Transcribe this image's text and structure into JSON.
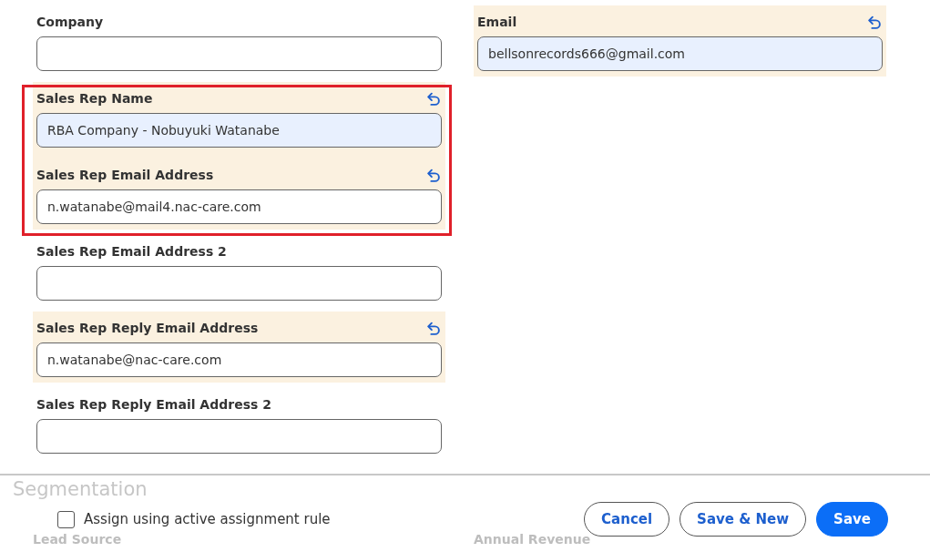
{
  "left_column": [
    {
      "kind": "field",
      "label": "Company",
      "changed": false,
      "autofilled": false
    },
    {
      "kind": "outlined_group",
      "fields": [
        {
          "label": "Sales Rep Name",
          "value": "RBA Company - Nobuyuki Watanabe",
          "changed": true,
          "autofilled": true
        },
        {
          "label": "Sales Rep Email Address",
          "value": "n.watanabe@mail4.nac-care.com",
          "changed": true,
          "autofilled": false
        }
      ]
    },
    {
      "kind": "field",
      "label": "Sales Rep Email Address 2",
      "changed": false,
      "autofilled": false
    },
    {
      "kind": "field",
      "label": "Sales Rep Reply Email Address",
      "value": "n.watanabe@nac-care.com",
      "changed": true,
      "autofilled": false
    },
    {
      "kind": "field",
      "label": "Sales Rep Reply Email Address 2",
      "changed": false,
      "autofilled": false
    }
  ],
  "right_column": [
    {
      "kind": "field",
      "label": "Email",
      "value": "bellsonrecords666@gmail.com",
      "changed": true,
      "autofilled": true
    }
  ],
  "next_section": {
    "title": "Segmentation",
    "labels": [
      "Lead Source",
      "Annual Revenue"
    ]
  },
  "footer": {
    "checkbox": {
      "label": "Assign using active assignment rule",
      "checked": false
    },
    "buttons": [
      {
        "label": "Cancel",
        "kind": "secondary"
      },
      {
        "label": "Save & New",
        "kind": "secondary"
      },
      {
        "label": "Save",
        "kind": "primary"
      }
    ]
  }
}
